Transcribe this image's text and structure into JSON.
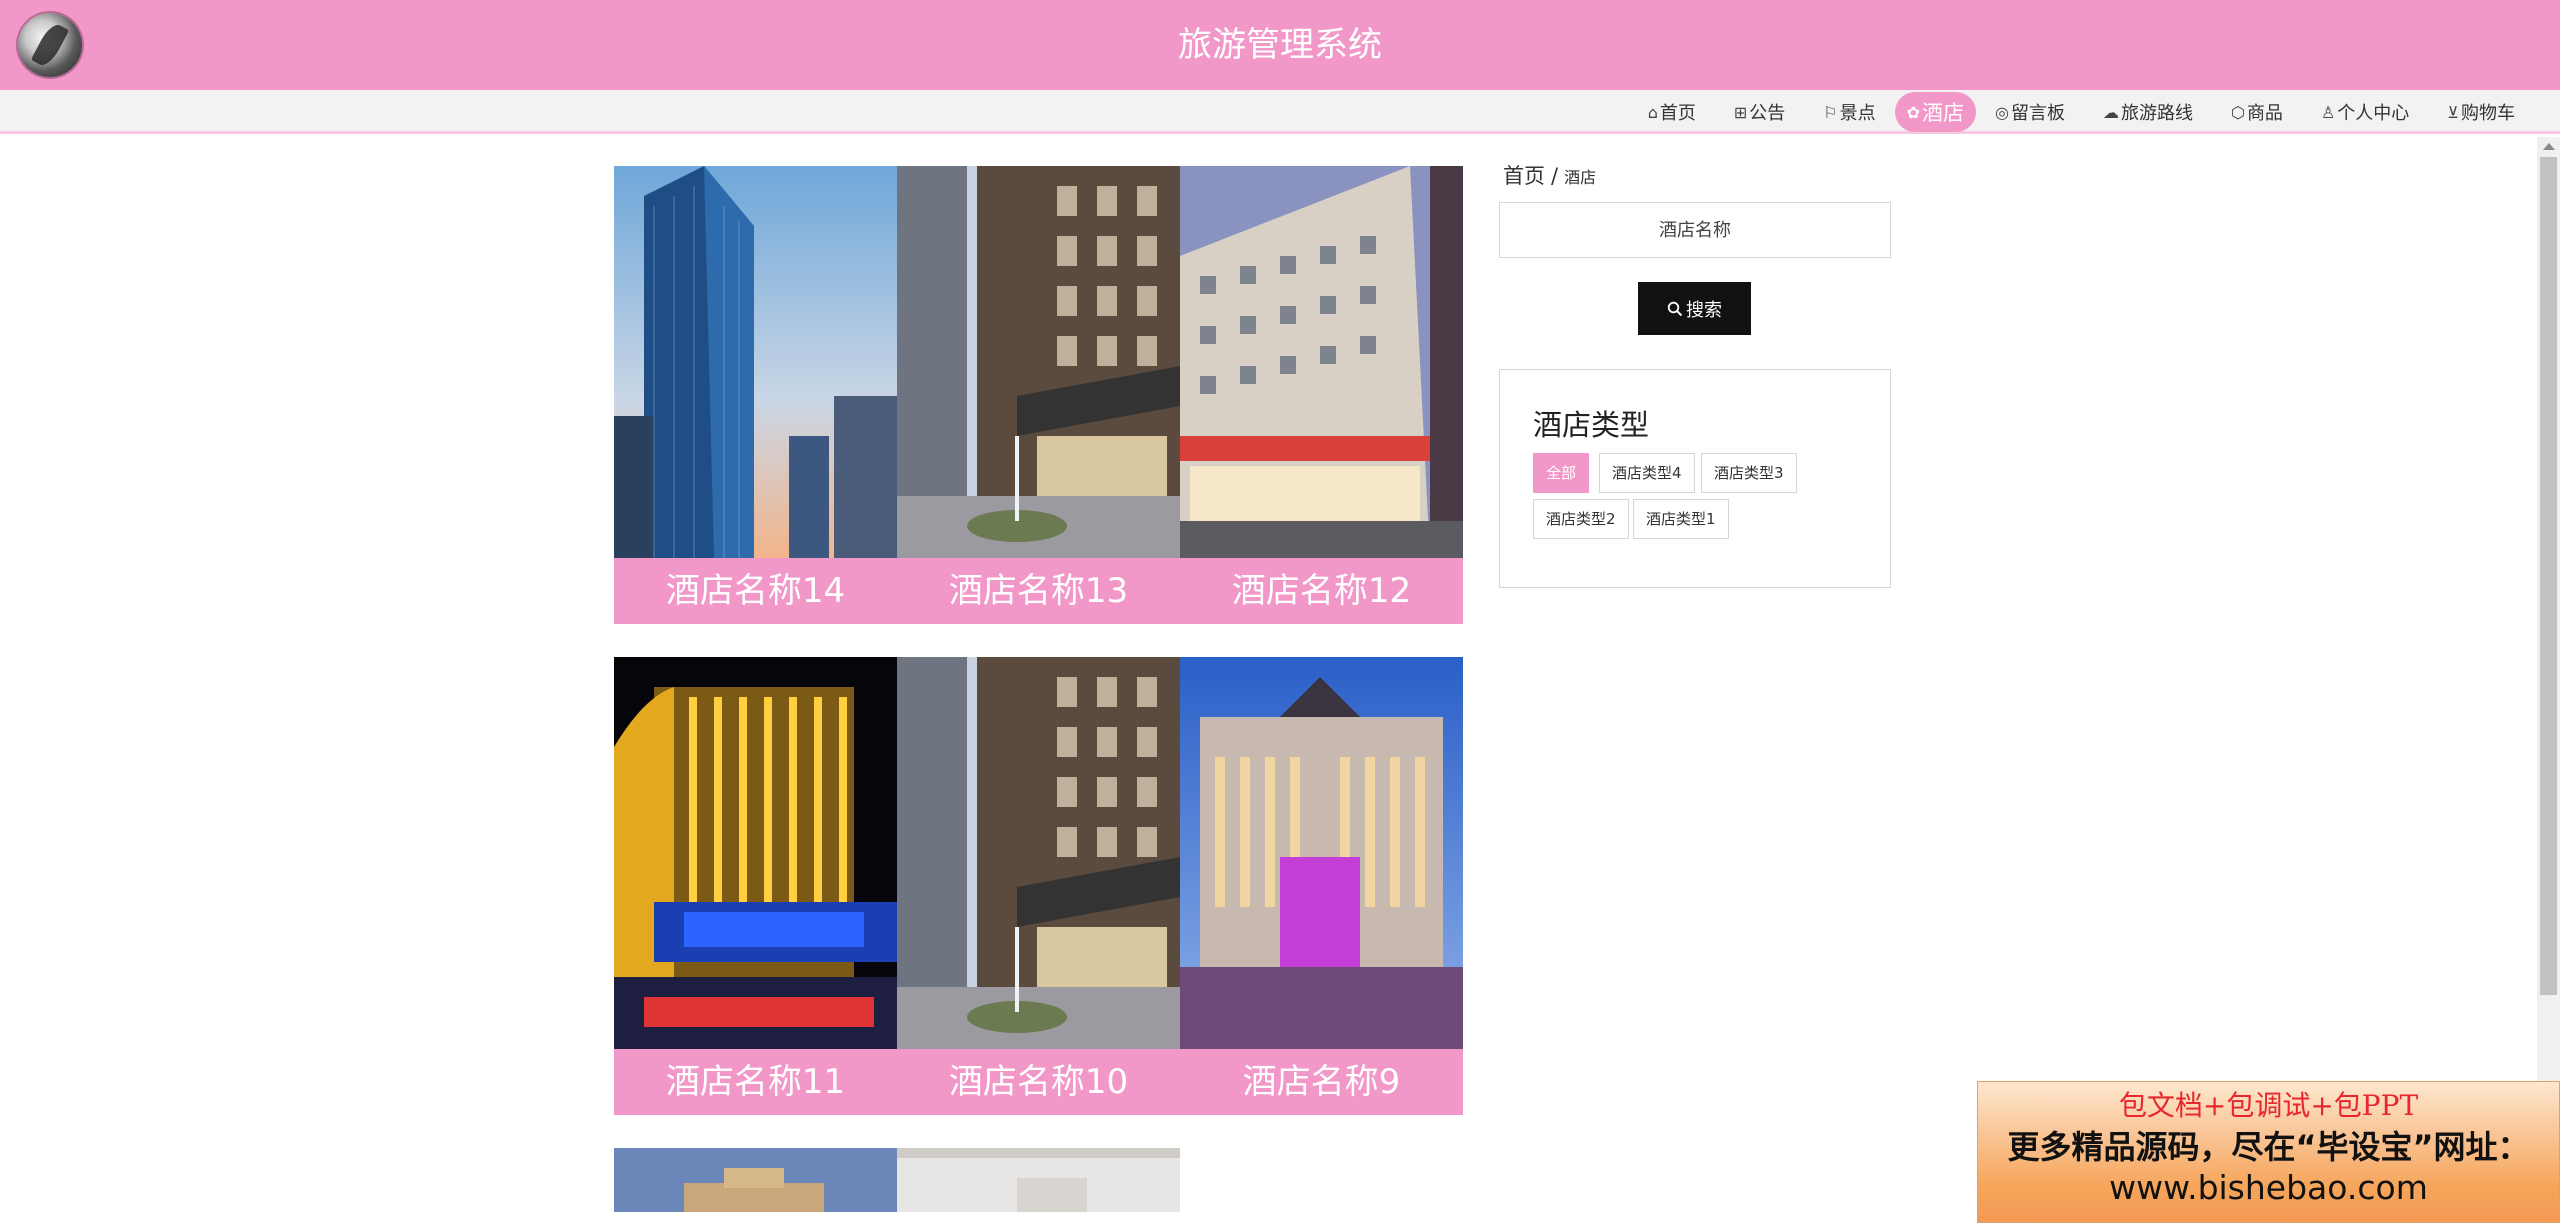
{
  "header": {
    "title": "旅游管理系统"
  },
  "nav": [
    {
      "label": "首页",
      "icon": "home-icon"
    },
    {
      "label": "公告",
      "icon": "gift-icon"
    },
    {
      "label": "景点",
      "icon": "flag-icon"
    },
    {
      "label": "酒店",
      "icon": "hotel-icon",
      "active": true
    },
    {
      "label": "留言板",
      "icon": "message-icon"
    },
    {
      "label": "旅游路线",
      "icon": "cloud-icon"
    },
    {
      "label": "商品",
      "icon": "box-icon"
    },
    {
      "label": "个人中心",
      "icon": "user-icon"
    },
    {
      "label": "购物车",
      "icon": "cart-icon"
    }
  ],
  "hotels": [
    [
      "酒店名称14",
      "酒店名称13",
      "酒店名称12"
    ],
    [
      "酒店名称11",
      "酒店名称10",
      "酒店名称9"
    ]
  ],
  "breadcrumb": {
    "home": "首页",
    "sep": "/",
    "current": "酒店"
  },
  "search": {
    "placeholder": "酒店名称",
    "button": "搜索"
  },
  "types": {
    "title": "酒店类型",
    "items": [
      {
        "label": "全部",
        "active": true
      },
      {
        "label": "酒店类型4"
      },
      {
        "label": "酒店类型3"
      },
      {
        "label": "酒店类型2"
      },
      {
        "label": "酒店类型1"
      }
    ]
  },
  "ad": {
    "line1": "包文档+包调试+包PPT",
    "line2": "更多精品源码，尽在“毕设宝”网址：",
    "line3": "www.bishebao.com"
  },
  "colors": {
    "primary": "#f198c8",
    "button": "#111111",
    "nav_bg": "#f2f2f2"
  }
}
